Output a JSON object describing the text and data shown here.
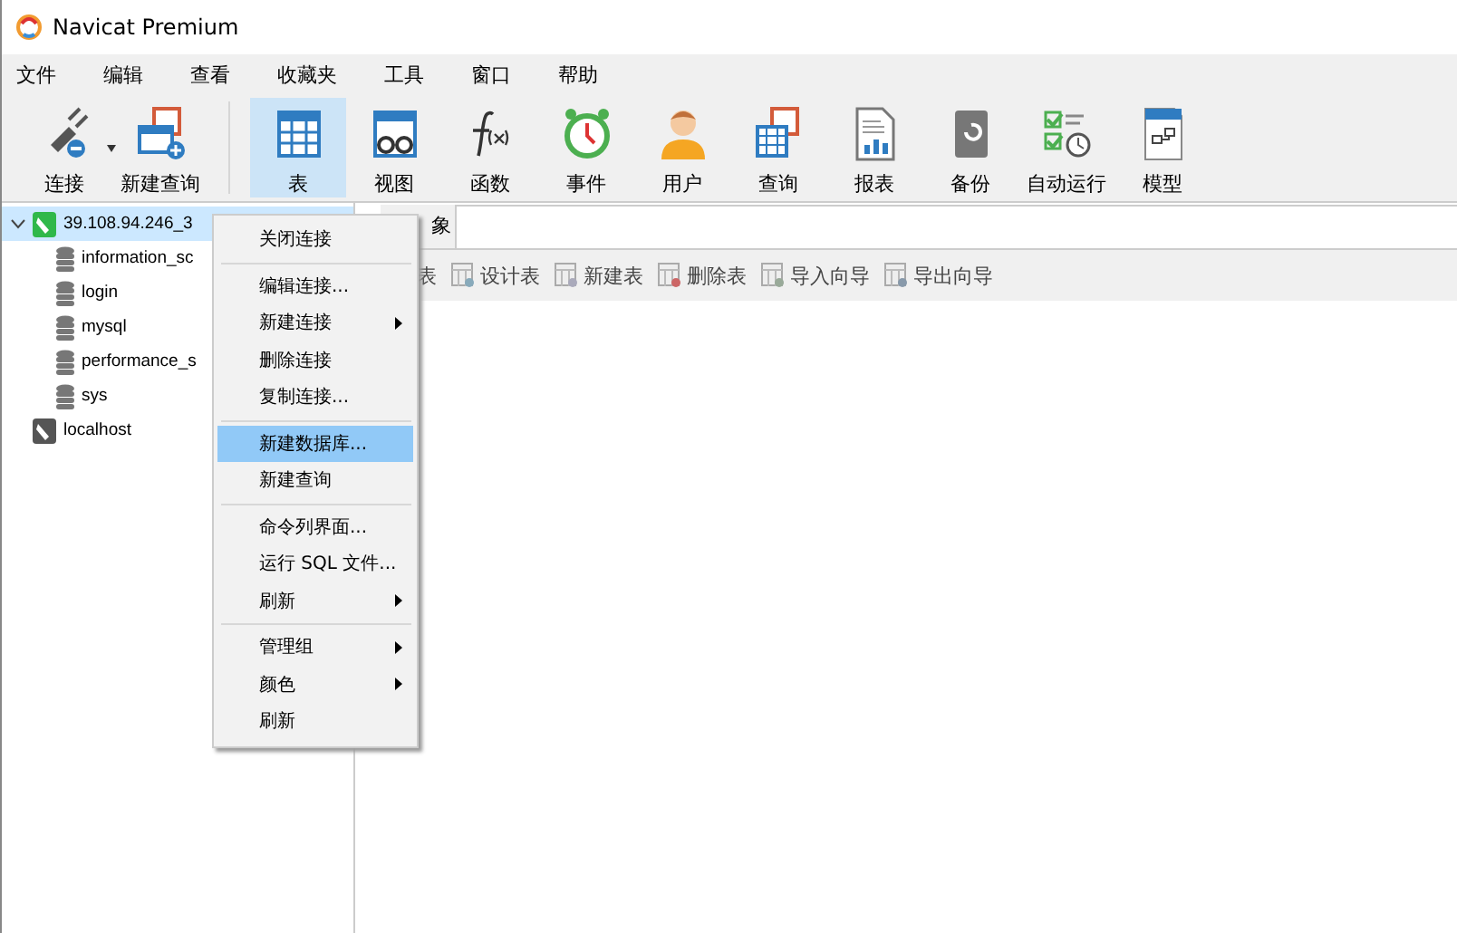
{
  "window": {
    "title": "Navicat Premium"
  },
  "menu_bar": [
    "文件",
    "编辑",
    "查看",
    "收藏夹",
    "工具",
    "窗口",
    "帮助"
  ],
  "toolbar": [
    {
      "kind": "button",
      "label": "连接",
      "selected": false,
      "dropdown": true
    },
    {
      "kind": "button",
      "label": "新建查询",
      "selected": false,
      "dropdown": false
    },
    {
      "kind": "separator"
    },
    {
      "kind": "button",
      "label": "表",
      "selected": true,
      "dropdown": false
    },
    {
      "kind": "button",
      "label": "视图",
      "selected": false,
      "dropdown": false
    },
    {
      "kind": "button",
      "label": "函数",
      "selected": false,
      "dropdown": false
    },
    {
      "kind": "button",
      "label": "事件",
      "selected": false,
      "dropdown": false
    },
    {
      "kind": "button",
      "label": "用户",
      "selected": false,
      "dropdown": false
    },
    {
      "kind": "button",
      "label": "查询",
      "selected": false,
      "dropdown": false
    },
    {
      "kind": "button",
      "label": "报表",
      "selected": false,
      "dropdown": false
    },
    {
      "kind": "button",
      "label": "备份",
      "selected": false,
      "dropdown": false
    },
    {
      "kind": "button",
      "label": "自动运行",
      "selected": false,
      "dropdown": false
    },
    {
      "kind": "button",
      "label": "模型",
      "selected": false,
      "dropdown": false
    }
  ],
  "tree": [
    {
      "label": "39.108.94.246_3",
      "kind": "connection",
      "selected": true,
      "expanded": true,
      "children": [
        {
          "label": "information_sc",
          "kind": "database"
        },
        {
          "label": "login",
          "kind": "database"
        },
        {
          "label": "mysql",
          "kind": "database"
        },
        {
          "label": "performance_s",
          "kind": "database"
        },
        {
          "label": "sys",
          "kind": "database"
        }
      ]
    },
    {
      "label": "localhost",
      "kind": "connection",
      "selected": false,
      "expanded": false
    }
  ],
  "tab": {
    "label": "象"
  },
  "object_toolbar": [
    "表",
    "设计表",
    "新建表",
    "删除表",
    "导入向导",
    "导出向导"
  ],
  "context_menu": [
    {
      "kind": "item",
      "label": "关闭连接",
      "submenu": false,
      "selected": false
    },
    {
      "kind": "separator"
    },
    {
      "kind": "item",
      "label": "编辑连接...",
      "submenu": false,
      "selected": false
    },
    {
      "kind": "item",
      "label": "新建连接",
      "submenu": true,
      "selected": false
    },
    {
      "kind": "item",
      "label": "删除连接",
      "submenu": false,
      "selected": false
    },
    {
      "kind": "item",
      "label": "复制连接...",
      "submenu": false,
      "selected": false
    },
    {
      "kind": "separator"
    },
    {
      "kind": "item",
      "label": "新建数据库...",
      "submenu": false,
      "selected": true
    },
    {
      "kind": "item",
      "label": "新建查询",
      "submenu": false,
      "selected": false
    },
    {
      "kind": "separator"
    },
    {
      "kind": "item",
      "label": "命令列界面...",
      "submenu": false,
      "selected": false
    },
    {
      "kind": "item",
      "label": "运行 SQL 文件...",
      "submenu": false,
      "selected": false
    },
    {
      "kind": "item",
      "label": "刷新",
      "submenu": true,
      "selected": false
    },
    {
      "kind": "separator"
    },
    {
      "kind": "item",
      "label": "管理组",
      "submenu": true,
      "selected": false
    },
    {
      "kind": "item",
      "label": "颜色",
      "submenu": true,
      "selected": false
    },
    {
      "kind": "item",
      "label": "刷新",
      "submenu": false,
      "selected": false
    }
  ]
}
